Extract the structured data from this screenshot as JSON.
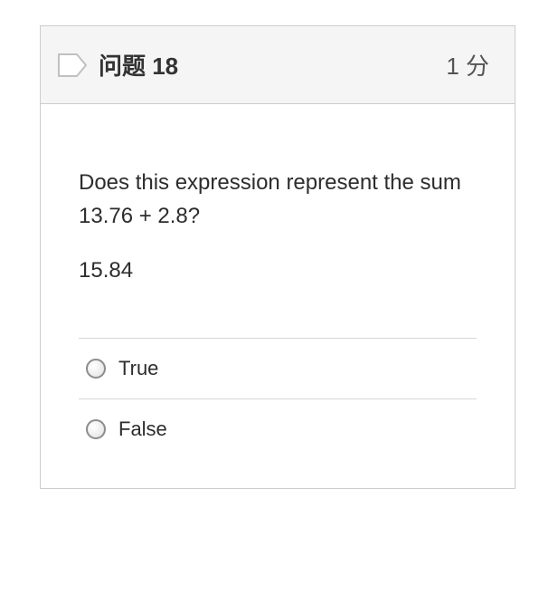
{
  "header": {
    "title": "问题 18",
    "points": "1 分"
  },
  "question": {
    "prompt": "Does this expression represent the sum 13.76 + 2.8?",
    "value": "15.84"
  },
  "answers": [
    {
      "label": "True"
    },
    {
      "label": "False"
    }
  ]
}
